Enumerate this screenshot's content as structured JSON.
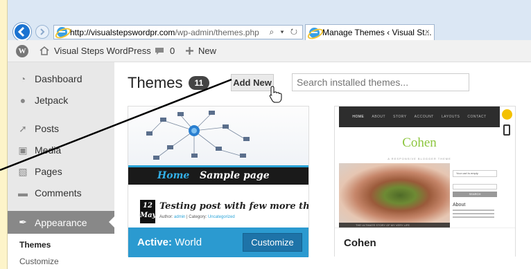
{
  "browser": {
    "url_host": "http://visualstepswordpr.com",
    "url_path": "/wp-admin/themes.php",
    "address_controls": "⌕ ▾ ↻",
    "tab_title": "Manage Themes ‹ Visual St...",
    "tab_close": "×"
  },
  "adminbar": {
    "site_name": "Visual Steps WordPress",
    "comments_count": "0",
    "new_label": "New"
  },
  "sidebar": {
    "items": [
      {
        "label": "Dashboard",
        "icon": "dashboard-icon"
      },
      {
        "label": "Jetpack",
        "icon": "jetpack-icon"
      },
      {
        "label": "Posts",
        "icon": "pin-icon"
      },
      {
        "label": "Media",
        "icon": "media-icon"
      },
      {
        "label": "Pages",
        "icon": "pages-icon"
      },
      {
        "label": "Comments",
        "icon": "comments-icon"
      },
      {
        "label": "Appearance",
        "icon": "brush-icon"
      }
    ],
    "submenu": [
      {
        "label": "Themes"
      },
      {
        "label": "Customize"
      }
    ]
  },
  "main": {
    "title": "Themes",
    "count": "11",
    "add_new": "Add New",
    "search_placeholder": "Search installed themes..."
  },
  "themes": [
    {
      "name": "World",
      "active_prefix": "Active:",
      "customize": "Customize",
      "preview": {
        "nav_home": "Home",
        "nav_sample": "Sample page",
        "date_day": "12",
        "date_month": "May",
        "post_title": "Testing post with few more things",
        "meta_author_label": "Author:",
        "meta_author": "admin",
        "meta_category_label": "| Category:",
        "meta_category": "Uncategorized"
      }
    },
    {
      "name": "Cohen",
      "preview": {
        "nav": [
          "HOME",
          "ABOUT",
          "STORY",
          "ACCOUNT",
          "LAYOUTS",
          "CONTACT"
        ],
        "logo": "Cohen",
        "tagline": "A RESPONSIVE BLOGGER THEME",
        "side_box": "Your cart is empty",
        "side_button": "SEARCH",
        "side_heading": "About"
      }
    }
  ],
  "colors": {
    "accent_blue": "#2b9ad0",
    "customize_blue": "#1e73a8",
    "cohen_green": "#8dc63f"
  }
}
